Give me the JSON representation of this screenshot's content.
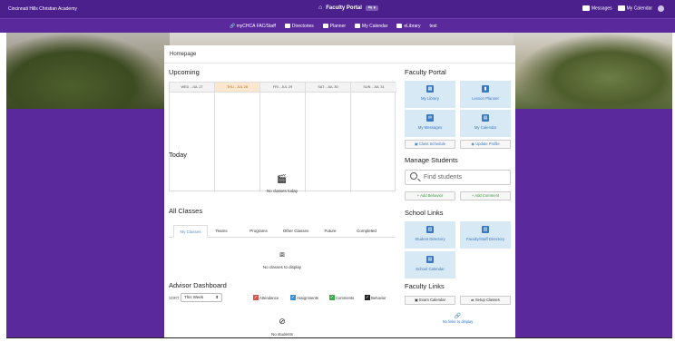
{
  "topbar": {
    "school": "Cincinnati Hills Christian Academy",
    "portal": "Faculty Portal",
    "messages": "Messages",
    "calendar": "My Calendar"
  },
  "subnav": {
    "items": [
      "myCHCA FAC/Staff",
      "Directories",
      "Planner",
      "My Calendar",
      "eLibrary",
      "test"
    ]
  },
  "breadcrumb": "Homepage",
  "upcoming": {
    "title": "Upcoming",
    "days": [
      "WED - JUL 27",
      "THU - JUL 28",
      "FRI - JUL 29",
      "SAT - JUL 30",
      "SUN - JUL 31"
    ]
  },
  "today": {
    "title": "Today",
    "empty": "No classes today"
  },
  "all_classes": {
    "title": "All Classes",
    "tabs": [
      "My Classes",
      "Teams",
      "Programs",
      "Other Classes",
      "Future",
      "Completed"
    ],
    "empty": "No classes to display"
  },
  "advisor": {
    "title": "Advisor Dashboard",
    "sort_label": "SORT",
    "sort_value": "This Week",
    "legend": [
      "Attendance",
      "Assignments",
      "Comments",
      "Behavior"
    ],
    "legend_colors": [
      "#d9534f",
      "#3a8fd6",
      "#3aa94a",
      "#222222"
    ],
    "empty": "No students"
  },
  "faculty_portal": {
    "title": "Faculty Portal",
    "tiles": [
      "My Library",
      "Lesson Planner",
      "My Messages",
      "My Calendar"
    ],
    "class_schedule": "Class Schedule",
    "update_profile": "Update Profile"
  },
  "manage_students": {
    "title": "Manage Students",
    "placeholder": "Find students",
    "add_behavior": "Add Behavior",
    "add_comment": "Add Comment"
  },
  "school_links": {
    "title": "School Links",
    "tiles": [
      "Student Directory",
      "Faculty/Staff Directory",
      "School Calendar"
    ]
  },
  "faculty_links": {
    "title": "Faculty Links",
    "exam_calendar": "Exam Calendar",
    "setup_classes": "Setup Classes",
    "empty": "No links to display"
  }
}
